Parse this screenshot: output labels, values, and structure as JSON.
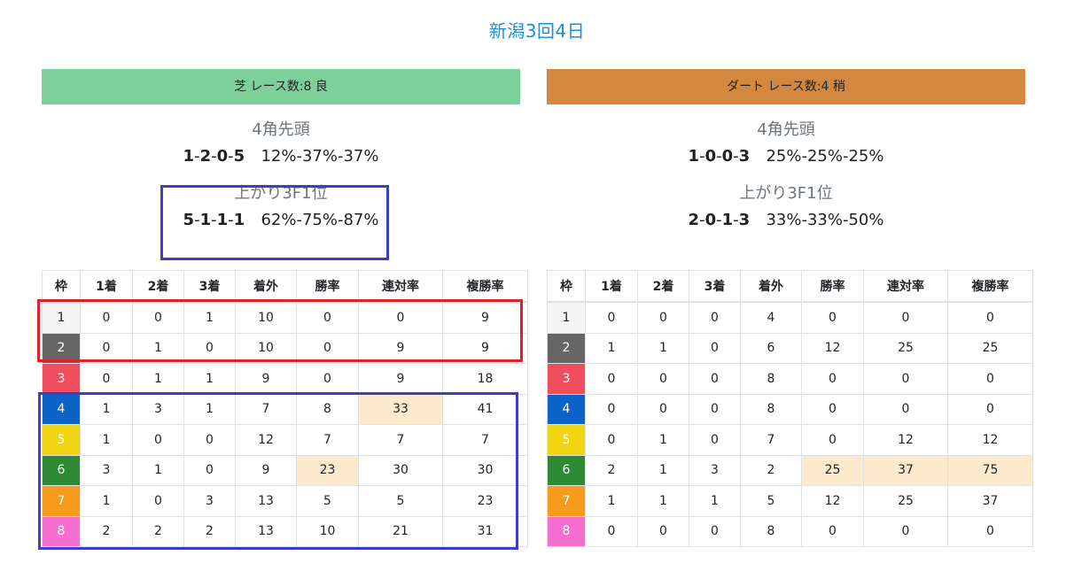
{
  "title": "新潟3回4日",
  "turf": {
    "header": "芝 レース数:8  良",
    "pos_label": "4角先頭",
    "pos_counts": [
      "1",
      "2",
      "0",
      "5"
    ],
    "pos_rates": "12%-37%-37%",
    "agari_label": "上がり3F1位",
    "agari_counts": [
      "5",
      "1",
      "1",
      "1"
    ],
    "agari_rates": "62%-75%-87%",
    "columns": [
      "枠",
      "1着",
      "2着",
      "3着",
      "着外",
      "勝率",
      "連対率",
      "複勝率"
    ],
    "rows": [
      [
        "1",
        "0",
        "0",
        "1",
        "10",
        "0",
        "0",
        "9"
      ],
      [
        "2",
        "0",
        "1",
        "0",
        "10",
        "0",
        "9",
        "9"
      ],
      [
        "3",
        "0",
        "1",
        "1",
        "9",
        "0",
        "9",
        "18"
      ],
      [
        "4",
        "1",
        "3",
        "1",
        "7",
        "8",
        "33",
        "41"
      ],
      [
        "5",
        "1",
        "0",
        "0",
        "12",
        "7",
        "7",
        "7"
      ],
      [
        "6",
        "3",
        "1",
        "0",
        "9",
        "23",
        "30",
        "30"
      ],
      [
        "7",
        "1",
        "0",
        "3",
        "13",
        "5",
        "5",
        "23"
      ],
      [
        "8",
        "2",
        "2",
        "2",
        "13",
        "10",
        "21",
        "31"
      ]
    ]
  },
  "dirt": {
    "header": "ダート レース数:4  稍",
    "pos_label": "4角先頭",
    "pos_counts": [
      "1",
      "0",
      "0",
      "3"
    ],
    "pos_rates": "25%-25%-25%",
    "agari_label": "上がり3F1位",
    "agari_counts": [
      "2",
      "0",
      "1",
      "3"
    ],
    "agari_rates": "33%-33%-50%",
    "columns": [
      "枠",
      "1着",
      "2着",
      "3着",
      "着外",
      "勝率",
      "連対率",
      "複勝率"
    ],
    "rows": [
      [
        "1",
        "0",
        "0",
        "0",
        "4",
        "0",
        "0",
        "0"
      ],
      [
        "2",
        "1",
        "1",
        "0",
        "6",
        "12",
        "25",
        "25"
      ],
      [
        "3",
        "0",
        "0",
        "0",
        "8",
        "0",
        "0",
        "0"
      ],
      [
        "4",
        "0",
        "0",
        "0",
        "8",
        "0",
        "0",
        "0"
      ],
      [
        "5",
        "0",
        "1",
        "0",
        "7",
        "0",
        "12",
        "12"
      ],
      [
        "6",
        "2",
        "1",
        "3",
        "2",
        "25",
        "37",
        "75"
      ],
      [
        "7",
        "1",
        "1",
        "1",
        "5",
        "12",
        "25",
        "37"
      ],
      [
        "8",
        "0",
        "0",
        "0",
        "8",
        "0",
        "0",
        "0"
      ]
    ]
  },
  "highlight_color": "#fde9cc",
  "annotation_colors": {
    "blue": "#3b3fc4",
    "red": "#e0202a"
  }
}
